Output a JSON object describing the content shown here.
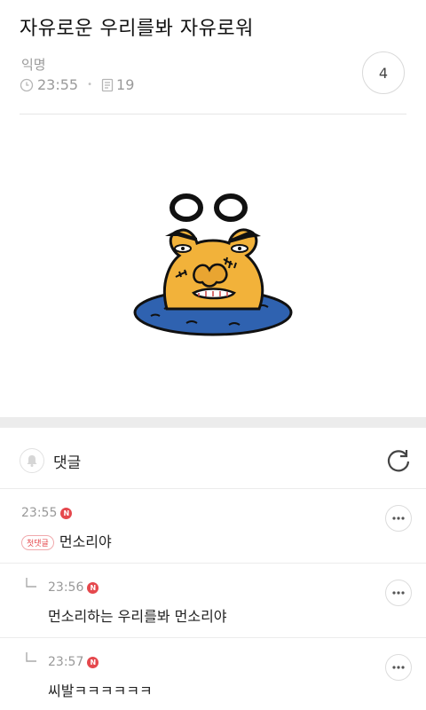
{
  "post": {
    "title": "자유로운 우리를봐 자유로워",
    "author": "익명",
    "time": "23:55",
    "views": "19",
    "comment_count": "4"
  },
  "comments_section": {
    "title": "댓글"
  },
  "comments": [
    {
      "time": "23:55",
      "new_badge": "N",
      "first_badge": "첫댓글",
      "text": "먼소리야"
    },
    {
      "time": "23:56",
      "new_badge": "N",
      "text": "먼소리하는 우리를봐 먼소리야"
    },
    {
      "time": "23:57",
      "new_badge": "N",
      "text": "씨발ㅋㅋㅋㅋㅋㅋ"
    }
  ],
  "icons": {
    "clock": "clock-icon",
    "views": "document-icon",
    "bell": "bell-icon",
    "refresh": "refresh-icon",
    "more": "more-icon",
    "reply": "reply-arrow-icon"
  },
  "colors": {
    "accent_red": "#e5484d",
    "sticker_yellow": "#f2b23a",
    "sticker_water": "#2f62b0"
  }
}
